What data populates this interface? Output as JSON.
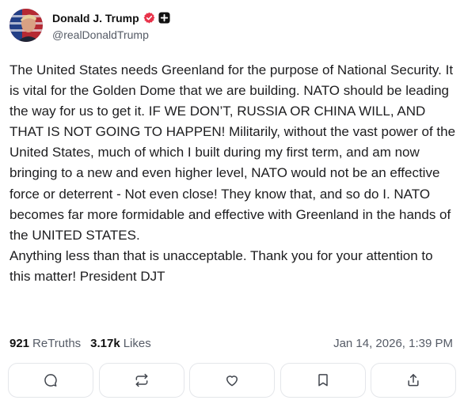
{
  "author": {
    "display_name": "Donald J. Trump",
    "handle": "@realDonaldTrump",
    "verified_icon": "verified-badge-icon",
    "plus_icon": "plus-badge-icon"
  },
  "post": {
    "text": "The United States needs Greenland for the purpose of National Security. It is vital for the Golden Dome that we are building. NATO should be leading the way for us to get it. IF WE DON’T, RUSSIA OR CHINA WILL, AND THAT IS NOT GOING TO HAPPEN! Militarily, without the vast power of the United States, much of which I built during my first term, and am now bringing to a new and even higher level, NATO would not be an effective force or deterrent - Not even close! They know that, and so do I. NATO becomes far more formidable and effective with Greenland in the hands of the UNITED STATES.\nAnything less than that is unacceptable. Thank you for your attention to this matter! President DJT"
  },
  "stats": {
    "retruths_count": "921",
    "retruths_label": "ReTruths",
    "likes_count": "3.17k",
    "likes_label": "Likes",
    "timestamp": "Jan 14, 2026, 1:39 PM"
  },
  "actions": [
    {
      "icon": "reply-icon"
    },
    {
      "icon": "retruth-icon"
    },
    {
      "icon": "like-icon"
    },
    {
      "icon": "bookmark-icon"
    },
    {
      "icon": "share-icon"
    }
  ],
  "colors": {
    "verified": "#e8334a",
    "text": "#1d1d1f",
    "muted": "#555b66",
    "border": "#e4e6ea"
  }
}
